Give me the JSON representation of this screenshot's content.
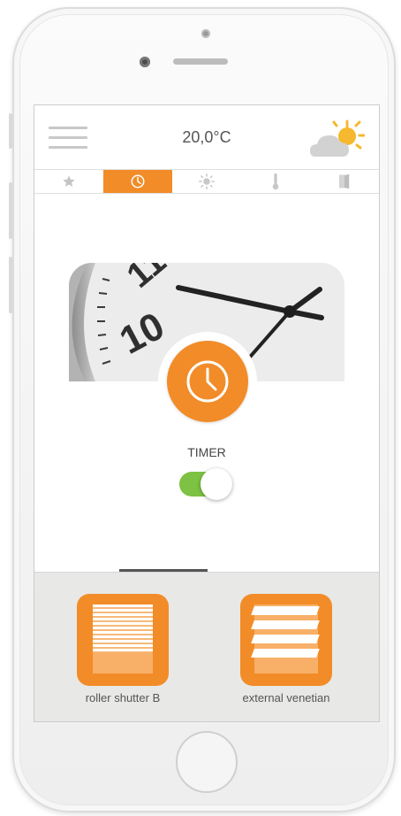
{
  "header": {
    "temperature": "20,0°C",
    "menu_icon": "hamburger-menu-icon",
    "weather_icon": "partly-sunny-icon"
  },
  "tabs": [
    {
      "icon": "star-icon",
      "active": false
    },
    {
      "icon": "clock-icon",
      "active": true
    },
    {
      "icon": "sun-icon",
      "active": false
    },
    {
      "icon": "thermometer-icon",
      "active": false
    },
    {
      "icon": "door-icon",
      "active": false
    }
  ],
  "timer": {
    "label": "TIMER",
    "enabled": true
  },
  "devices": [
    {
      "label": "roller shutter B",
      "icon": "roller-shutter-icon"
    },
    {
      "label": "external venetian",
      "icon": "venetian-blind-icon"
    }
  ],
  "colors": {
    "accent": "#f28c28",
    "toggle_on": "#7dc242",
    "panel_bg": "#e8e8e7"
  }
}
